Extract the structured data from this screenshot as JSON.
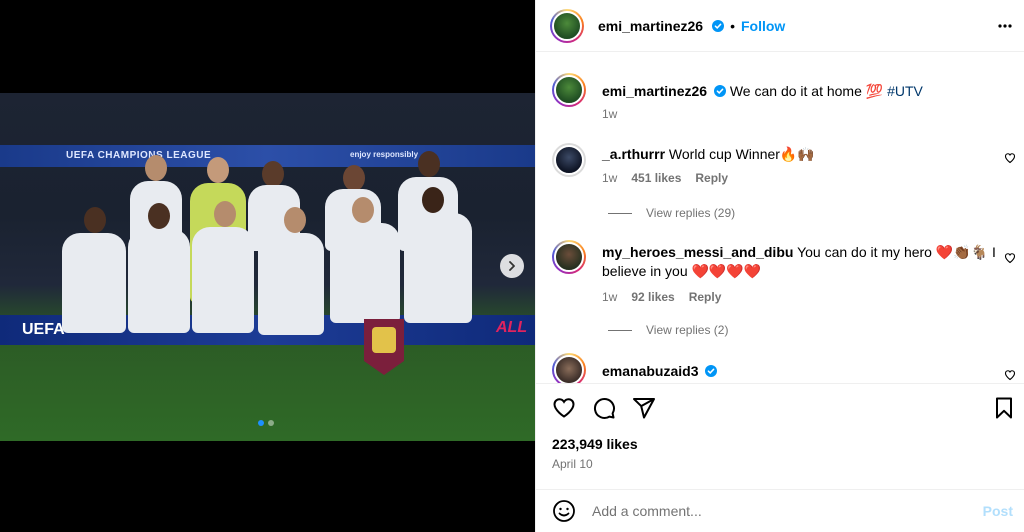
{
  "post": {
    "author": "emi_martinez26",
    "follow_label": "Follow",
    "caption": {
      "username": "emi_martinez26",
      "text": "We can do it at home 💯",
      "hashtag": "#UTV",
      "time": "1w"
    },
    "photo": {
      "banner_left": "UEFA CHAMPIONS LEAGUE",
      "banner_right": "enjoy responsibly",
      "board_left": "UEFA",
      "board_right": "ALL"
    },
    "carousel": {
      "count": 2,
      "active": 0
    }
  },
  "comments": [
    {
      "username": "_a.rthurrr",
      "text": "World cup Winner🔥🙌🏾",
      "time": "1w",
      "likes": "451 likes",
      "reply_label": "Reply",
      "view_replies": "View replies (29)"
    },
    {
      "username": "my_heroes_messi_and_dibu",
      "text": "You can do it my hero ❤️👏🏾🐐 I believe in you ❤️❤️❤️❤️",
      "time": "1w",
      "likes": "92 likes",
      "reply_label": "Reply",
      "view_replies": "View replies (2)"
    },
    {
      "username": "emanabuzaid3",
      "text": ""
    }
  ],
  "footer": {
    "likes": "223,949 likes",
    "date": "April 10",
    "comment_placeholder": "Add a comment...",
    "post_label": "Post"
  },
  "colors": {
    "accent": "#0095f6",
    "verified": "#0095f6",
    "muted": "#737373",
    "post_disabled": "#b2dffc",
    "heart_red": "#e0234b"
  }
}
